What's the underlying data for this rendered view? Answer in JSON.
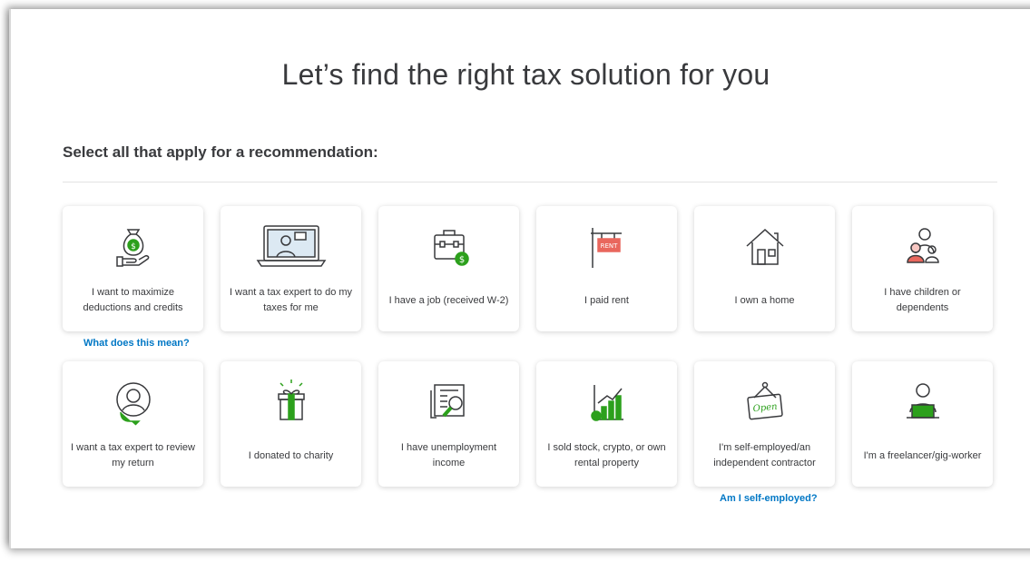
{
  "header": {
    "title": "Let’s find the right tax solution for you",
    "subtitle": "Select all that apply for a recommendation:"
  },
  "cards": [
    {
      "label": "I want to maximize deductions and credits",
      "icon": "money-bag-hand-icon"
    },
    {
      "label": "I want a tax expert to do my taxes for me",
      "icon": "laptop-expert-icon"
    },
    {
      "label": "I have a job (received W-2)",
      "icon": "briefcase-icon"
    },
    {
      "label": "I paid rent",
      "icon": "rent-sign-icon"
    },
    {
      "label": "I own a home",
      "icon": "house-icon"
    },
    {
      "label": "I have children or dependents",
      "icon": "family-icon"
    },
    {
      "label": "I want a tax expert to review my return",
      "icon": "expert-avatar-icon"
    },
    {
      "label": "I donated to charity",
      "icon": "gift-icon"
    },
    {
      "label": "I have unemployment income",
      "icon": "newspaper-search-icon"
    },
    {
      "label": "I sold stock, crypto, or own rental property",
      "icon": "stock-chart-icon"
    },
    {
      "label": "I'm self-employed/an independent contractor",
      "icon": "open-sign-icon"
    },
    {
      "label": "I'm a freelancer/gig-worker",
      "icon": "freelancer-laptop-icon"
    }
  ],
  "links": {
    "deductions_help": "What does this mean?",
    "self_employed_help": "Am I self-employed?"
  },
  "icon_texts": {
    "rent": "RENT",
    "open": "Open"
  },
  "colors": {
    "accent_green": "#2ca01c",
    "link_blue": "#0077c5",
    "rent_red": "#e9675d"
  }
}
